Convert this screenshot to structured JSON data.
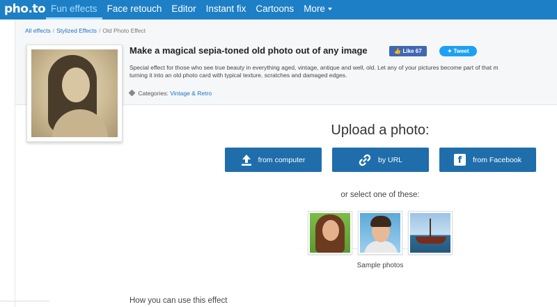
{
  "logo": "pho.to",
  "nav": [
    {
      "label": "Fun effects"
    },
    {
      "label": "Face retouch"
    },
    {
      "label": "Editor"
    },
    {
      "label": "Instant fix"
    },
    {
      "label": "Cartoons"
    },
    {
      "label": "More"
    }
  ],
  "breadcrumb": {
    "items": [
      "All effects",
      "Stylized Effects",
      "Old Photo Effect"
    ],
    "separator": "/"
  },
  "effect": {
    "title": "Make a magical sepia-toned old photo out of any image",
    "like_label": "Like 67",
    "tweet_label": "Tweet",
    "description_line1": "Special effect for those who see true beauty in everything aged, vintage, antique and well, old. Let any of your pictures become part of that m",
    "description_line2": "turning it into an old photo card with typical texture, scratches and damaged edges.",
    "categories_label": "Categories:",
    "category": "Vintage & Retro"
  },
  "upload": {
    "title": "Upload a photo:",
    "from_computer": "from computer",
    "by_url": "by URL",
    "from_facebook": "from Facebook",
    "select_text": "or select one of these:",
    "samples_caption": "Sample photos"
  },
  "how_heading": "How you can use this effect",
  "colors": {
    "nav_bg": "#1d7fc5",
    "button_bg": "#1f6eab",
    "link": "#1a73c6",
    "facebook": "#4267b2",
    "twitter": "#1da1f2"
  }
}
